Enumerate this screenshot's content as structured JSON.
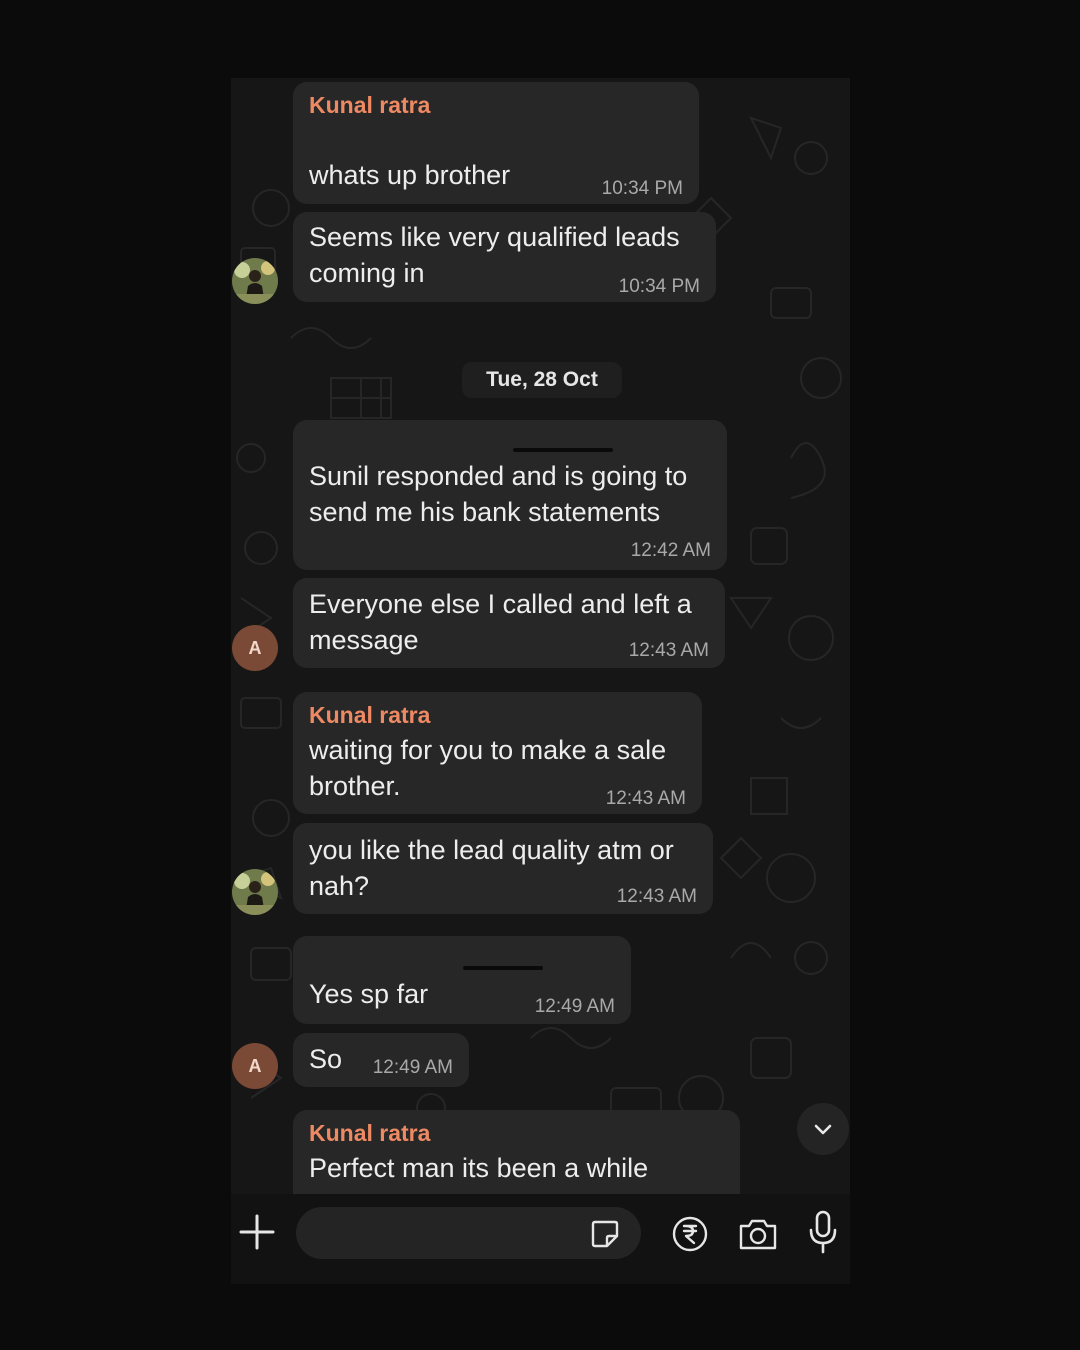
{
  "date_separator": "Tue, 28 Oct",
  "messages": [
    {
      "sender": "Kunal ratra",
      "text": "whats up brother",
      "time": "10:34 PM"
    },
    {
      "text": "Seems like very qualified leads\ncoming in",
      "time": "10:34 PM"
    },
    {
      "text": "Sunil responded and is going to\nsend me his bank statements",
      "time": "12:42 AM"
    },
    {
      "text": "Everyone else I called and left a\nmessage",
      "time": "12:43 AM"
    },
    {
      "sender": "Kunal ratra",
      "text": "waiting for you to make a sale\nbrother.",
      "time": "12:43 AM"
    },
    {
      "text": "you like the lead quality atm or\nnah?",
      "time": "12:43 AM"
    },
    {
      "text": "Yes sp far",
      "time": "12:49 AM"
    },
    {
      "text": "So",
      "time": "12:49 AM"
    },
    {
      "sender": "Kunal ratra",
      "text": "Perfect man its been a while"
    }
  ],
  "avatars": {
    "letter": "A"
  },
  "composer": {
    "placeholder": ""
  },
  "icons": [
    "plus-icon",
    "sticker-icon",
    "rupee-icon",
    "camera-icon",
    "mic-icon",
    "chevron-down-icon"
  ],
  "colors": {
    "sender_name": "#ee8a63",
    "bubble": "#272727",
    "background": "#161616"
  }
}
